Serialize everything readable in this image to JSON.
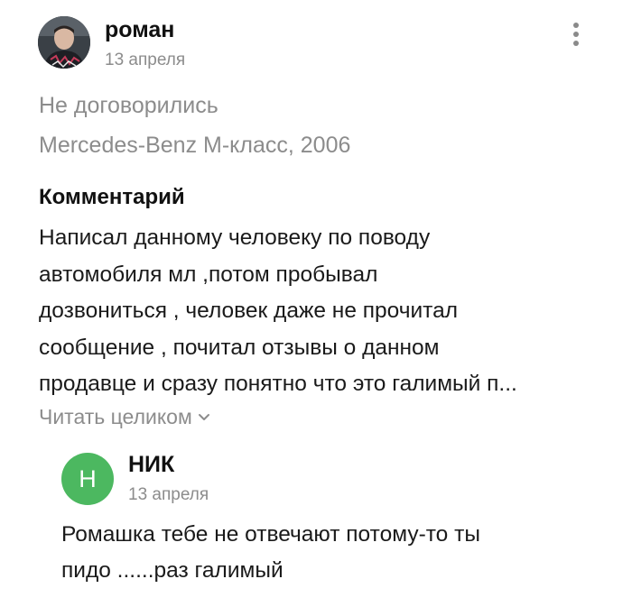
{
  "review": {
    "author": {
      "name": "роман",
      "date": "13 апреля",
      "avatar_icon": "user-photo"
    },
    "more_icon": "vertical-dots-icon",
    "deal_status": "Не договорились",
    "car": "Mercedes-Benz M-класс, 2006",
    "comment_heading": "Комментарий",
    "comment_lines": [
      "Написал данному человеку по поводу",
      "автомобиля мл ,потом пробывал",
      "дозвониться , человек даже не прочитал",
      "сообщение , почитал отзывы о данном",
      "продавце и сразу понятно что это галимый п..."
    ],
    "read_more_label": "Читать целиком",
    "read_more_icon": "chevron-down-icon"
  },
  "reply": {
    "author": {
      "name": "НИК",
      "initial": "Н",
      "date": "13 апреля",
      "avatar_color": "#4cb860"
    },
    "text_lines": [
      "Ромашка тебе не отвечают потому-то ты",
      "пидо ......раз галимый"
    ]
  }
}
